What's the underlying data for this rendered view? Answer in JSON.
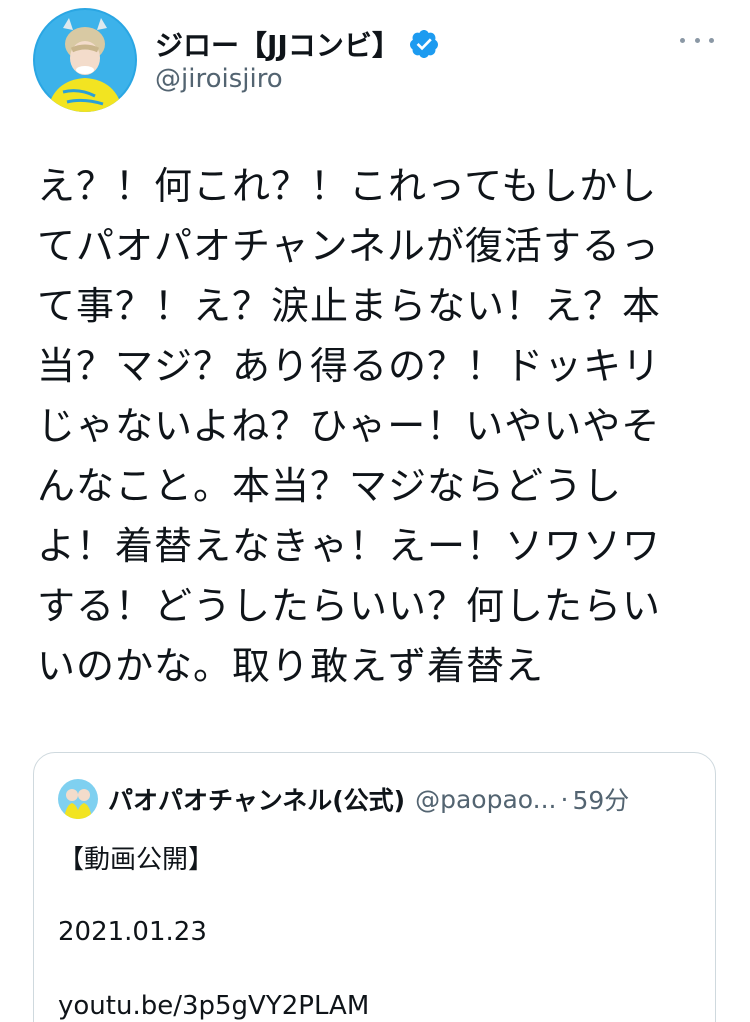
{
  "tweet": {
    "author": {
      "display_name": "ジロー【JJコンビ】",
      "handle": "@jiroisjiro",
      "verified": true,
      "avatar_icon": "profile-avatar"
    },
    "more_icon": "more-horizontal-icon",
    "text": "え？！何これ？！これってもしかし\nてパオパオチャンネルが復活するっ\nて事？！え？涙止まらない！え？本\n当？マジ？あり得るの？！ドッキリ\nじゃないよね？ひゃー！いやいやそ\nんなこと。本当？マジならどうし\nよ！着替えなきゃ！えー！ソワソワ\nする！どうしたらいい？何したらい\nいのかな。取り敢えず着替え"
  },
  "quote": {
    "display_name": "パオパオチャンネル(公式)",
    "handle": "@paopao...",
    "separator": "·",
    "time": "59分",
    "lines": [
      "【動画公開】",
      "2021.01.23",
      "youtu.be/3p5gVY2PLAM"
    ]
  },
  "colors": {
    "text": "#0f1419",
    "secondary": "#536471",
    "verified_blue": "#1d9bf0",
    "border": "#cfd9de",
    "avatar_bg": "#29a3e0",
    "shirt_yellow": "#f0e020"
  }
}
